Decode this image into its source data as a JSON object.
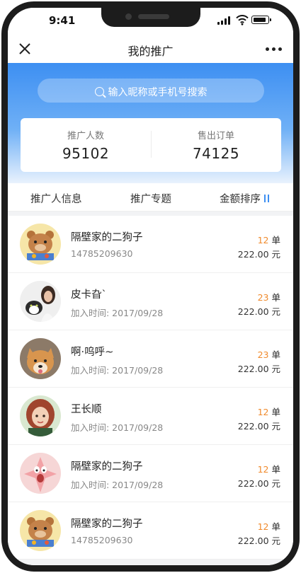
{
  "status_bar": {
    "time": "9:41"
  },
  "nav": {
    "title": "我的推广"
  },
  "search": {
    "placeholder": "输入昵称或手机号搜索"
  },
  "stats": [
    {
      "label": "推广人数",
      "value": "95102"
    },
    {
      "label": "售出订单",
      "value": "74125"
    }
  ],
  "tabs": [
    {
      "label": "推广人信息"
    },
    {
      "label": "推广专题"
    },
    {
      "label": "金额排序"
    }
  ],
  "accent_color": "#3d8ff2",
  "highlight_color": "#f08a2c",
  "rows": [
    {
      "name": "隔壁家的二狗子",
      "sub": "14785209630",
      "count": "12",
      "count_unit": "单",
      "amount": "222.00 元",
      "avatar": "bear-avatar"
    },
    {
      "name": "皮卡旮`",
      "sub": "加入时间: 2017/09/28",
      "count": "23",
      "count_unit": "单",
      "amount": "222.00 元",
      "avatar": "girl-with-cat-avatar"
    },
    {
      "name": "啊·呜呼~",
      "sub": "加入时间: 2017/09/28",
      "count": "23",
      "count_unit": "单",
      "amount": "222.00 元",
      "avatar": "shiba-dog-avatar"
    },
    {
      "name": "王长顺",
      "sub": "加入时间: 2017/09/28",
      "count": "12",
      "count_unit": "单",
      "amount": "222.00 元",
      "avatar": "cartoon-girl-avatar"
    },
    {
      "name": "隔壁家的二狗子",
      "sub": "加入时间: 2017/09/28",
      "count": "12",
      "count_unit": "单",
      "amount": "222.00 元",
      "avatar": "patrick-star-avatar"
    },
    {
      "name": "隔壁家的二狗子",
      "sub": "14785209630",
      "count": "12",
      "count_unit": "单",
      "amount": "222.00 元",
      "avatar": "bear-avatar"
    }
  ]
}
